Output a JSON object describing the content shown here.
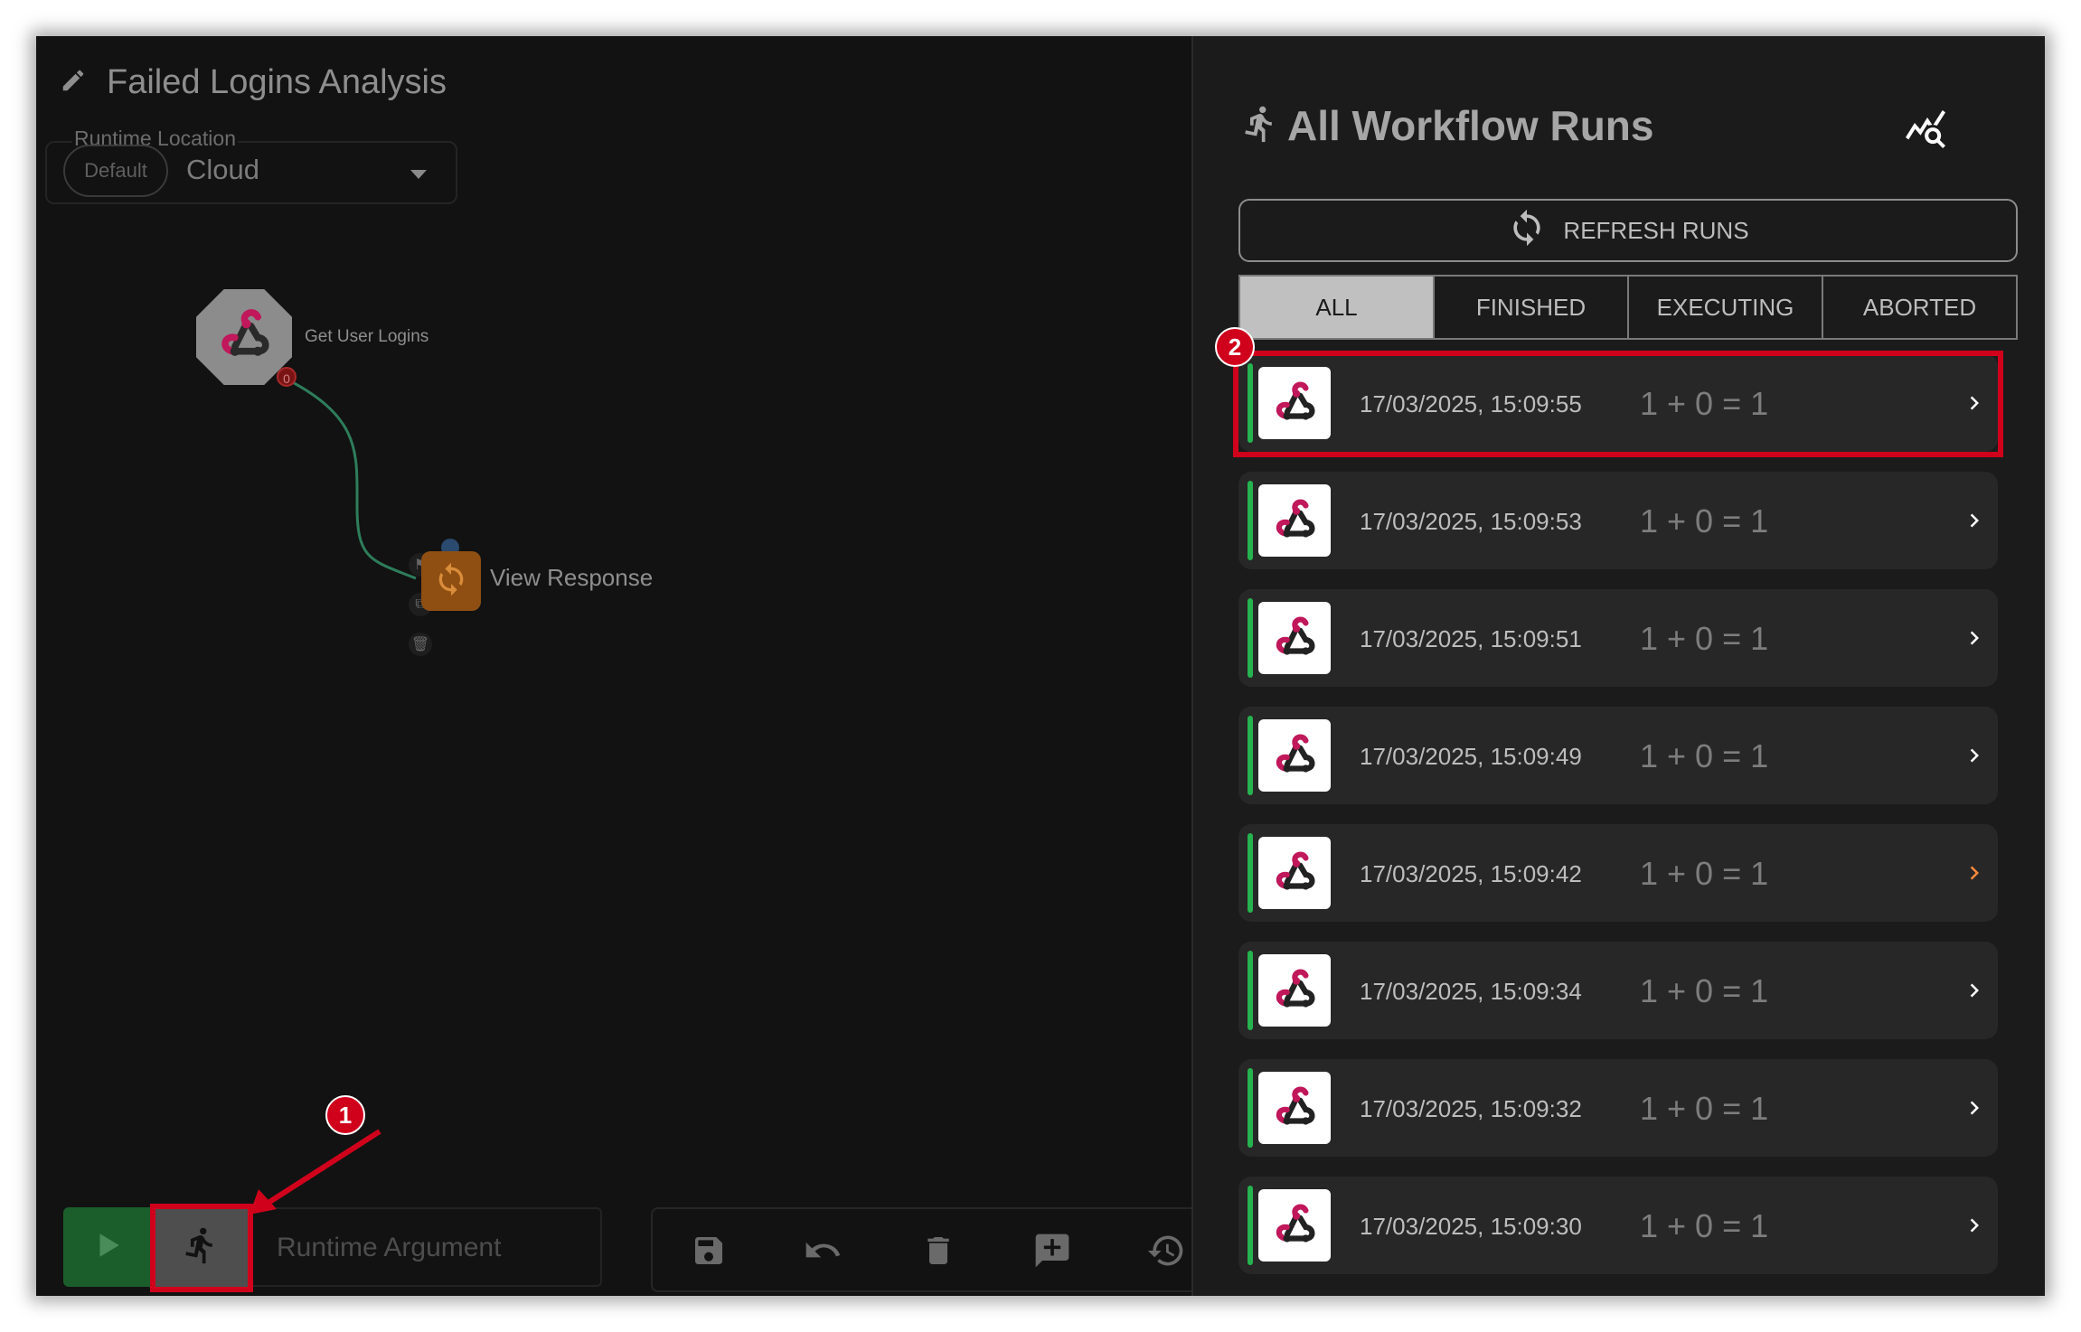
{
  "workflow": {
    "title": "Failed Logins Analysis",
    "runtime_location_label": "Runtime Location",
    "runtime_default_chip": "Default",
    "runtime_location_value": "Cloud"
  },
  "nodes": [
    {
      "label": "Get User Logins",
      "badge": "0",
      "icon": "webhook-icon"
    },
    {
      "label": "View Response",
      "icon": "sync-icon"
    }
  ],
  "toolbar": {
    "runtime_argument_placeholder": "Runtime Argument",
    "tools": [
      "save-icon",
      "undo-icon",
      "delete-icon",
      "add-comment-icon",
      "history-icon"
    ]
  },
  "annotations": {
    "marker_1": "1",
    "marker_2": "2"
  },
  "runs_panel": {
    "title": "All Workflow Runs",
    "refresh_label": "REFRESH RUNS",
    "tabs": [
      {
        "label": "ALL",
        "active": true
      },
      {
        "label": "FINISHED",
        "active": false
      },
      {
        "label": "EXECUTING",
        "active": false
      },
      {
        "label": "ABORTED",
        "active": false
      }
    ],
    "runs": [
      {
        "timestamp": "17/03/2025, 15:09:55",
        "count": "1 + 0 = 1",
        "status_color": "#26b24f",
        "chevron_color": "#ffffff"
      },
      {
        "timestamp": "17/03/2025, 15:09:53",
        "count": "1 + 0 = 1",
        "status_color": "#26b24f",
        "chevron_color": "#ffffff"
      },
      {
        "timestamp": "17/03/2025, 15:09:51",
        "count": "1 + 0 = 1",
        "status_color": "#26b24f",
        "chevron_color": "#ffffff"
      },
      {
        "timestamp": "17/03/2025, 15:09:49",
        "count": "1 + 0 = 1",
        "status_color": "#26b24f",
        "chevron_color": "#ffffff"
      },
      {
        "timestamp": "17/03/2025, 15:09:42",
        "count": "1 + 0 = 1",
        "status_color": "#26b24f",
        "chevron_color": "#ff8a3d"
      },
      {
        "timestamp": "17/03/2025, 15:09:34",
        "count": "1 + 0 = 1",
        "status_color": "#26b24f",
        "chevron_color": "#ffffff"
      },
      {
        "timestamp": "17/03/2025, 15:09:32",
        "count": "1 + 0 = 1",
        "status_color": "#26b24f",
        "chevron_color": "#ffffff"
      },
      {
        "timestamp": "17/03/2025, 15:09:30",
        "count": "1 + 0 = 1",
        "status_color": "#26b24f",
        "chevron_color": "#ffffff"
      }
    ]
  },
  "colors": {
    "accent_red": "#d0021b",
    "success_green": "#26b24f",
    "play_green": "#1b5e2b"
  }
}
